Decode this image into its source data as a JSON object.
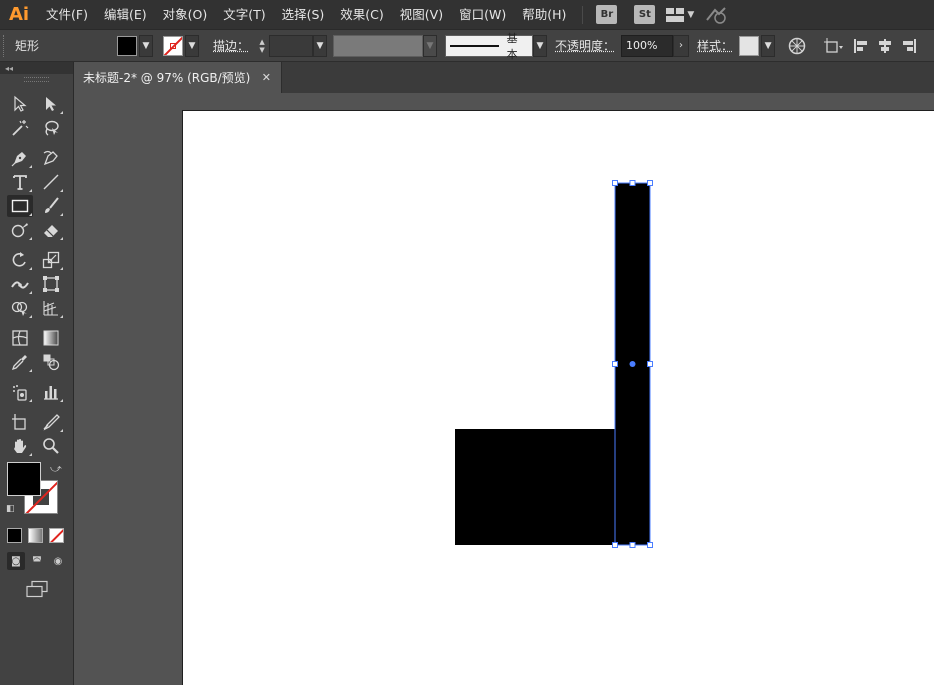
{
  "app": {
    "logo": "Ai"
  },
  "menu": {
    "items": [
      "文件(F)",
      "编辑(E)",
      "对象(O)",
      "文字(T)",
      "选择(S)",
      "效果(C)",
      "视图(V)",
      "窗口(W)",
      "帮助(H)"
    ],
    "bridge_label": "Br",
    "stock_label": "St"
  },
  "control_bar": {
    "tool_name": "矩形",
    "stroke_label": "描边：",
    "stroke_style_label": "基本",
    "opacity_label": "不透明度：",
    "opacity_value": "100%",
    "style_label": "样式：",
    "fill_color": "#000000"
  },
  "document": {
    "tab_title": "未标题-2* @ 97% (RGB/预览)",
    "close_glyph": "✕"
  },
  "colors": {
    "accent_selection": "#4a7dff",
    "artboard": "#ffffff",
    "fill": "#000000"
  }
}
